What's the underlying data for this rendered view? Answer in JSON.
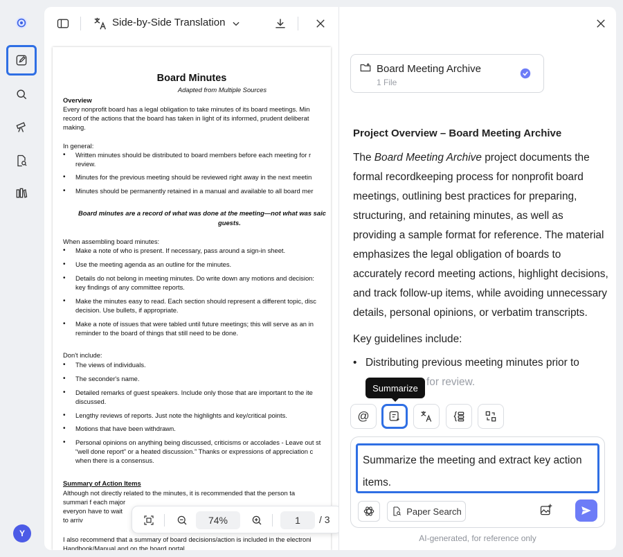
{
  "rail": {
    "icons": [
      "app-logo-icon",
      "edit-icon",
      "search-icon",
      "telescope-icon",
      "document-search-icon",
      "library-icon"
    ],
    "avatar_initial": "Y"
  },
  "viewer": {
    "mode_label": "Side-by-Side Translation",
    "zoom": "74%",
    "page_current": "1",
    "page_total": "/ 3"
  },
  "document": {
    "title": "Board Minutes",
    "subtitle": "Adapted from Multiple Sources",
    "overview_heading": "Overview",
    "overview_lines": [
      "Every nonprofit board has a legal obligation to take minutes of its board meetings. Min",
      "record of the actions that the board has taken in light of its informed, prudent deliberat",
      "making."
    ],
    "in_general": "In general:",
    "general_items": [
      [
        "Written minutes should be distributed to board members before each meeting for r",
        "review."
      ],
      [
        "Minutes for the previous meeting should be reviewed right away in the next meetin"
      ],
      [
        "Minutes should be permanently retained in a manual and available to all board mer"
      ]
    ],
    "callout": [
      "Board minutes are a record of what was done at the meeting—not what was saic",
      "guests."
    ],
    "assembling": "When assembling board minutes:",
    "assembling_items": [
      [
        "Make a note of who is present. If necessary, pass around a sign-in sheet."
      ],
      [
        "Use the meeting agenda as an outline for the minutes."
      ],
      [
        "Details do not belong in meeting minutes. Do write down any motions and decision:",
        "key findings of any committee reports."
      ],
      [
        "Make the minutes easy to read. Each section should represent a different topic, disc",
        "decision. Use bullets, if appropriate."
      ],
      [
        "Make a note of issues that were tabled until future meetings; this will serve as an in",
        "reminder to the board of things that still need to be done."
      ]
    ],
    "dont_include": "Don't include:",
    "dont_items": [
      [
        "The views of individuals."
      ],
      [
        "The seconder's name."
      ],
      [
        "Detailed remarks of guest speakers. Include only those that are important to the ite",
        "discussed."
      ],
      [
        "Lengthy reviews of reports. Just note the highlights and key/critical points."
      ],
      [
        "Motions that have been withdrawn."
      ],
      [
        "Personal opinions on anything being discussed, criticisms or accolades - Leave out st",
        "“well done report” or a heated discussion.” Thanks or expressions of appreciation c",
        "when there is a consensus."
      ]
    ],
    "summary_heading": "Summary of Action Items",
    "summary_lines": [
      "Although not directly related to the minutes, it is recommended that the person ta",
      "summari                                                                   f each major",
      "everyon                                                                    have to wait",
      "to arriv"
    ],
    "closing_line": "I also recommend that a summary of board decisions/action is included in the electroni",
    "closing_line2": "Handbook/Manual and on the board portal."
  },
  "chat": {
    "file_name": "Board Meeting Archive",
    "file_count": "1 File",
    "answer_heading": "Project Overview – Board Meeting Archive",
    "answer_pre": "The ",
    "answer_em": "Board Meeting Archive",
    "answer_post": " project documents the formal recordkeeping process for nonprofit board meetings, outlining best practices for preparing, structuring, and retaining minutes, as well as providing a sample format for reference. The material emphasizes the legal obligation of boards to accurately record meeting actions, highlight decisions, and track follow-up items, while avoiding unnecessary details, personal opinions, or verbatim transcripts.",
    "guidelines_intro": "Key guidelines include:",
    "guideline_1": "Distributing previous meeting minutes prior to",
    "guideline_1b": "for review.",
    "tooltip": "Summarize",
    "tools": [
      "at-mention-icon",
      "summarize-icon",
      "translate-icon",
      "outline-icon",
      "convert-icon"
    ],
    "input_text": "Summarize the meeting and extract key action items.",
    "paper_search_label": "Paper Search",
    "footnote": "AI-generated, for reference only"
  },
  "colors": {
    "accent": "#2f6fe4",
    "send_button": "#6d7cf7",
    "avatar": "#4c5be6"
  }
}
